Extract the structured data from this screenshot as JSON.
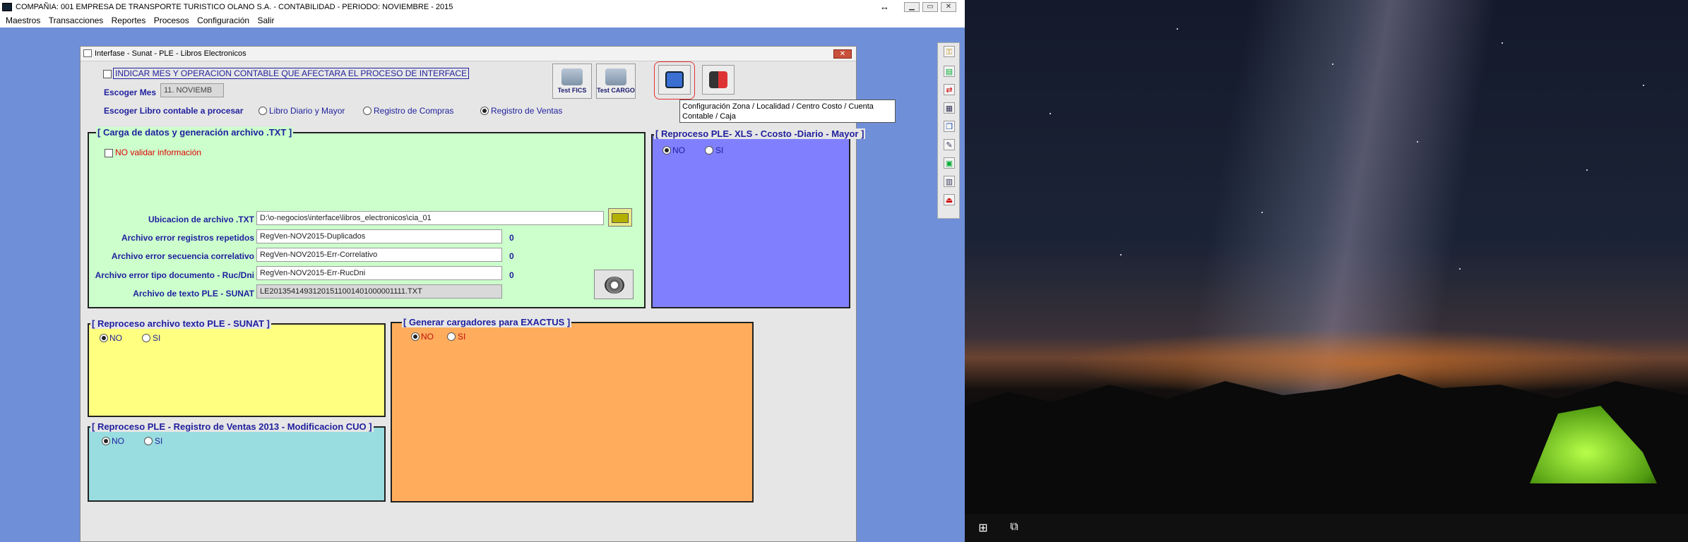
{
  "app": {
    "title": "COMPAÑIA:  001 EMPRESA DE TRANSPORTE TURISTICO OLANO S.A.   -   CONTABILIDAD   -    PERIODO: NOVIEMBRE - 2015",
    "resize_glyph": "↔",
    "menu": [
      "Maestros",
      "Transacciones",
      "Reportes",
      "Procesos",
      "Configuración",
      "Salir"
    ]
  },
  "dialog": {
    "title": "Interfase - Sunat - PLE - Libros Electronicos",
    "indicar_label": "INDICAR MES Y OPERACION CONTABLE QUE AFECTARA EL PROCESO DE INTERFACE",
    "mes_label": "Escoger Mes",
    "mes_value": "11. NOVIEMB",
    "libro_label": "Escoger Libro contable a procesar",
    "libro_options": [
      "Libro Diario y Mayor",
      "Registro de Compras",
      "Registro de Ventas"
    ],
    "libro_selected": "Registro de Ventas",
    "toolbar": {
      "test_fics": "Test FICS",
      "test_cargo": "Test CARGO"
    },
    "tooltip": "Configuración Zona / Localidad / Centro Costo / Cuenta Contable / Caja",
    "carga": {
      "title": "[ Carga de datos y generación archivo  .TXT ]",
      "no_validar": "NO validar información",
      "rows": [
        {
          "label": "Ubicacion de archivo .TXT",
          "value": "D:\\o-negocios\\interface\\libros_electronicos\\cia_01",
          "count": ""
        },
        {
          "label": "Archivo error registros repetidos",
          "value": "RegVen-NOV2015-Duplicados",
          "count": "0"
        },
        {
          "label": "Archivo error secuencia correlativo",
          "value": "RegVen-NOV2015-Err-Correlativo",
          "count": "0"
        },
        {
          "label": "Archivo error tipo documento - Ruc/Dni",
          "value": "RegVen-NOV2015-Err-RucDni",
          "count": "0"
        },
        {
          "label": "Archivo de texto PLE - SUNAT",
          "value": "LE20135414931201511001401000001111.TXT",
          "count": ""
        }
      ]
    },
    "panels": {
      "xls": {
        "title": "[ Reproceso PLE- XLS - Ccosto -Diario - Mayor ]",
        "no": "NO",
        "si": "SI"
      },
      "sunat": {
        "title": "[  Reproceso archivo texto PLE - SUNAT ]",
        "no": "NO",
        "si": "SI"
      },
      "exactus": {
        "title": "[  Generar cargadores para EXACTUS  ]",
        "no": "NO",
        "si": "SI"
      },
      "ventas2013": {
        "title": "[  Reproceso PLE - Registro de Ventas 2013 - Modificacion CUO  ]",
        "no": "NO",
        "si": "SI"
      }
    }
  },
  "colors": {
    "app_bg": "#6f8fd9",
    "carga_panel": "#ccffcc",
    "xls_panel": "#8080ff",
    "sunat_panel": "#ffff80",
    "exactus_panel": "#ffad5c",
    "ventas_panel": "#99dde0",
    "label_text": "#1f1f9e",
    "warning_text": "#e00000"
  },
  "icons": [
    "app-icon",
    "minimize-icon",
    "maximize-icon",
    "close-icon",
    "folder-icon",
    "gear-icon",
    "report-icon",
    "exit-door-icon",
    "windows-start-icon",
    "task-view-icon"
  ]
}
